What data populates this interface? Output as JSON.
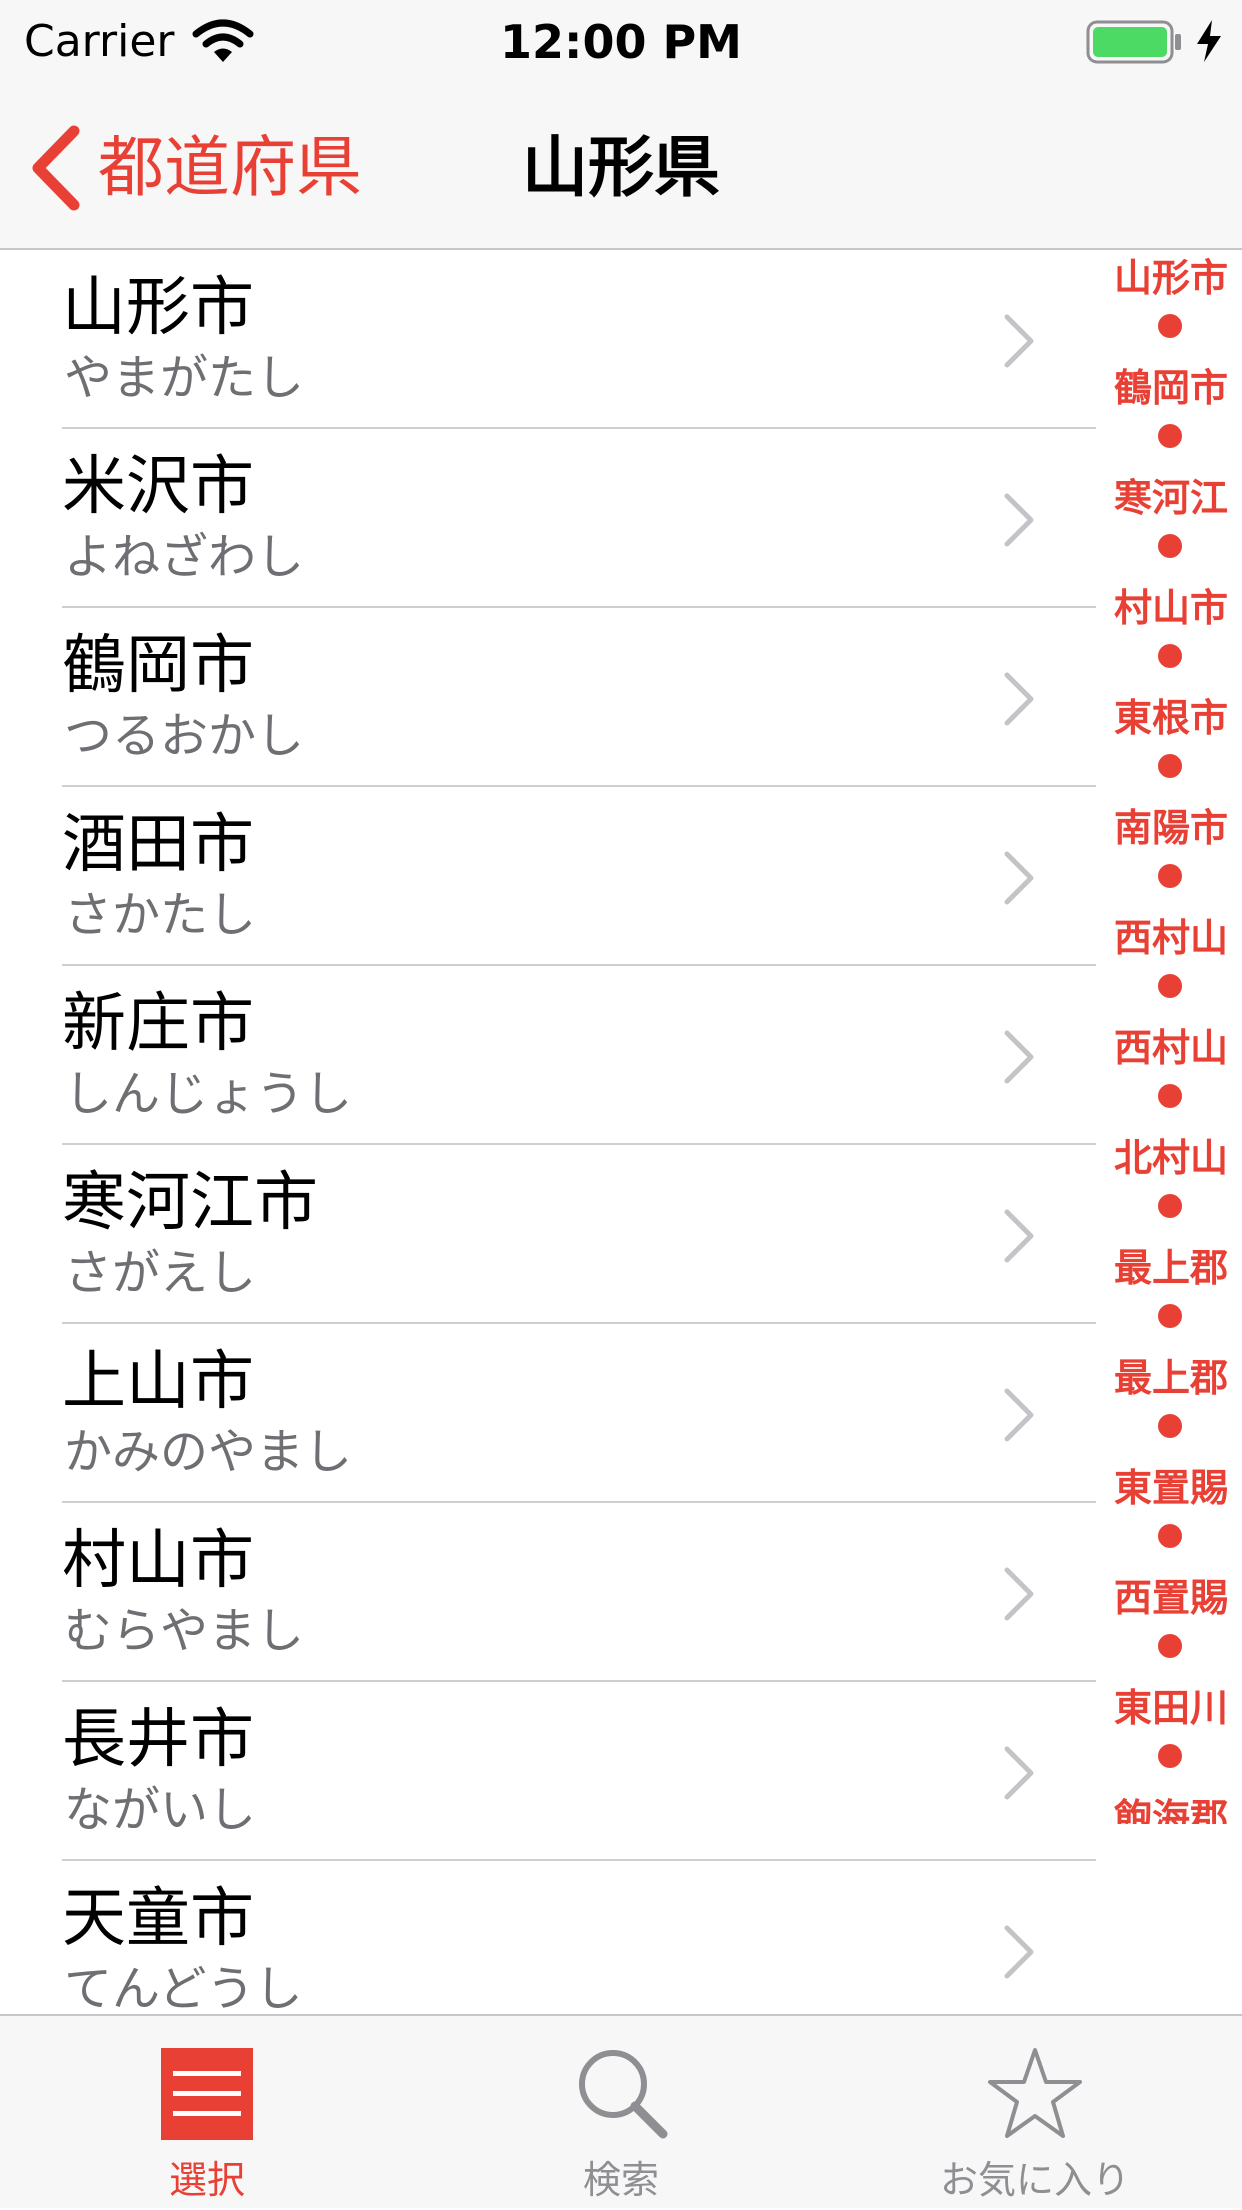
{
  "status_bar": {
    "carrier": "Carrier",
    "time": "12:00 PM",
    "icons": [
      "wifi-icon",
      "battery-icon",
      "charge-icon"
    ]
  },
  "nav_bar": {
    "back_label": "都道府県",
    "title": "山形県"
  },
  "cities": [
    {
      "name": "山形市",
      "kana": "やまがたし"
    },
    {
      "name": "米沢市",
      "kana": "よねざわし"
    },
    {
      "name": "鶴岡市",
      "kana": "つるおかし"
    },
    {
      "name": "酒田市",
      "kana": "さかたし"
    },
    {
      "name": "新庄市",
      "kana": "しんじょうし"
    },
    {
      "name": "寒河江市",
      "kana": "さがえし"
    },
    {
      "name": "上山市",
      "kana": "かみのやまし"
    },
    {
      "name": "村山市",
      "kana": "むらやまし"
    },
    {
      "name": "長井市",
      "kana": "ながいし"
    },
    {
      "name": "天童市",
      "kana": "てんどうし"
    }
  ],
  "section_index": [
    "山形市",
    "鶴岡市",
    "寒河江",
    "村山市",
    "東根市",
    "南陽市",
    "西村山",
    "西村山",
    "北村山",
    "最上郡",
    "最上郡",
    "東置賜",
    "西置賜",
    "東田川",
    "飽海郡"
  ],
  "tab_bar": {
    "tabs": [
      {
        "label": "選択",
        "icon": "list-icon",
        "selected": true
      },
      {
        "label": "検索",
        "icon": "search-icon",
        "selected": false
      },
      {
        "label": "お気に入り",
        "icon": "star-icon",
        "selected": false
      }
    ]
  },
  "colors": {
    "accent": "#e94035",
    "bar_background": "#f7f7f7",
    "inactive_tab": "#8e8e93",
    "secondary_text": "#6e6e73"
  }
}
